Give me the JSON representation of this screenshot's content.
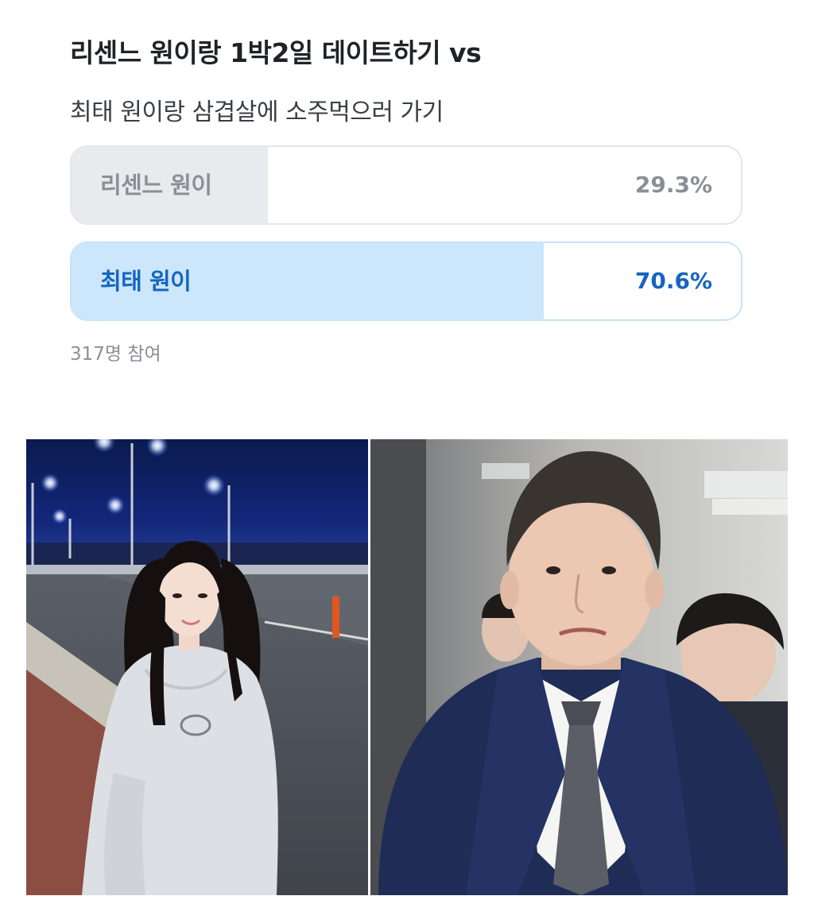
{
  "poll": {
    "title": "리센느 원이랑 1박2일 데이트하기 vs",
    "subtitle": "최태 원이랑 삼겹살에 소주먹으러 가기",
    "options": [
      {
        "label": "리센느 원이",
        "percent_text": "29.3%",
        "percent": 29.3
      },
      {
        "label": "최태 원이",
        "percent_text": "70.6%",
        "percent": 70.6
      }
    ],
    "participants": "317명 참여"
  },
  "colors": {
    "unselected_fill": "#e8eaed",
    "selected_fill": "#cce6fb",
    "selected_text": "#1565c0",
    "muted_text": "#8a8f96"
  },
  "photos": [
    {
      "subject": "woman-in-hoodie-on-bridge-at-night"
    },
    {
      "subject": "man-in-navy-suit-with-dotted-tie"
    }
  ]
}
